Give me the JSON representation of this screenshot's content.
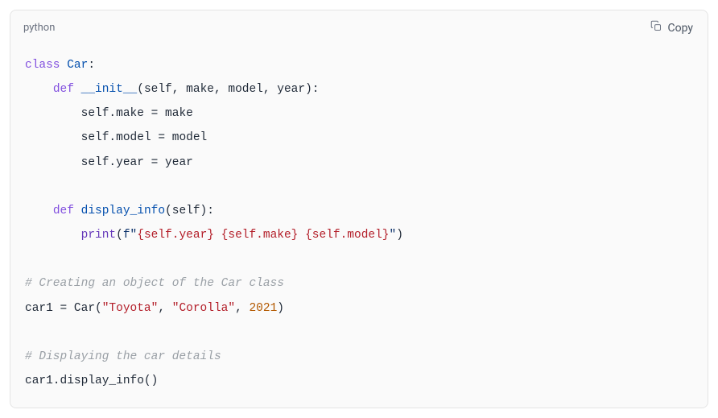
{
  "header": {
    "language": "python",
    "copy_label": "Copy"
  },
  "code": {
    "t1": "class",
    "t2": "Car",
    "t3": ":",
    "t4": "def",
    "t5": "__init__",
    "t6": "(self, make, model, year):",
    "t7": "self.make = make",
    "t8": "self.model = model",
    "t9": "self.year = year",
    "t10": "def",
    "t11": "display_info",
    "t12": "(self):",
    "t13": "print",
    "t14": "(",
    "t15": "f\"",
    "t16": "{self.year}",
    "t17": " ",
    "t18": "{self.make}",
    "t19": " ",
    "t20": "{self.model}",
    "t21": "\"",
    "t22": ")",
    "t23": "# Creating an object of the Car class",
    "t24": "car1 = Car(",
    "t25": "\"Toyota\"",
    "t26": ", ",
    "t27": "\"Corolla\"",
    "t28": ", ",
    "t29": "2021",
    "t30": ")",
    "t31": "# Displaying the car details",
    "t32": "car1.display_info()"
  }
}
